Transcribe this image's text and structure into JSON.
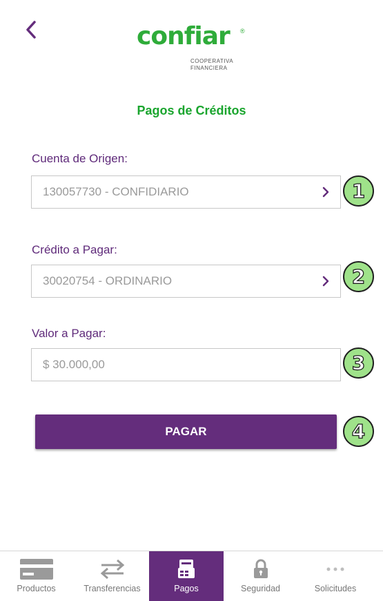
{
  "header": {
    "logo_text": "confiar",
    "logo_reg": "®",
    "logo_sub_line1": "COOPERATIVA",
    "logo_sub_line2": "FINANCIERA"
  },
  "page": {
    "title": "Pagos de Créditos"
  },
  "form": {
    "origin_account": {
      "label": "Cuenta de Origen:",
      "value": "130057730 - CONFIDIARIO",
      "step": "1"
    },
    "credit": {
      "label": "Crédito a Pagar:",
      "value": "30020754 - ORDINARIO",
      "step": "2"
    },
    "amount": {
      "label": "Valor a Pagar:",
      "value": "$ 30.000,00",
      "step": "3"
    },
    "pay_button": {
      "label": "PAGAR",
      "step": "4"
    }
  },
  "tabs": [
    {
      "label": "Productos",
      "icon": "card-icon",
      "active": false
    },
    {
      "label": "Transferencias",
      "icon": "transfer-arrows-icon",
      "active": false
    },
    {
      "label": "Pagos",
      "icon": "payment-icon",
      "active": true
    },
    {
      "label": "Seguridad",
      "icon": "lock-icon",
      "active": false
    },
    {
      "label": "Solicitudes",
      "icon": "more-dots-icon",
      "active": false
    }
  ],
  "colors": {
    "brand_purple": "#642d7c",
    "brand_green": "#2fac3a",
    "title_green": "#1aa52e",
    "step_badge": "#9fe28a"
  }
}
